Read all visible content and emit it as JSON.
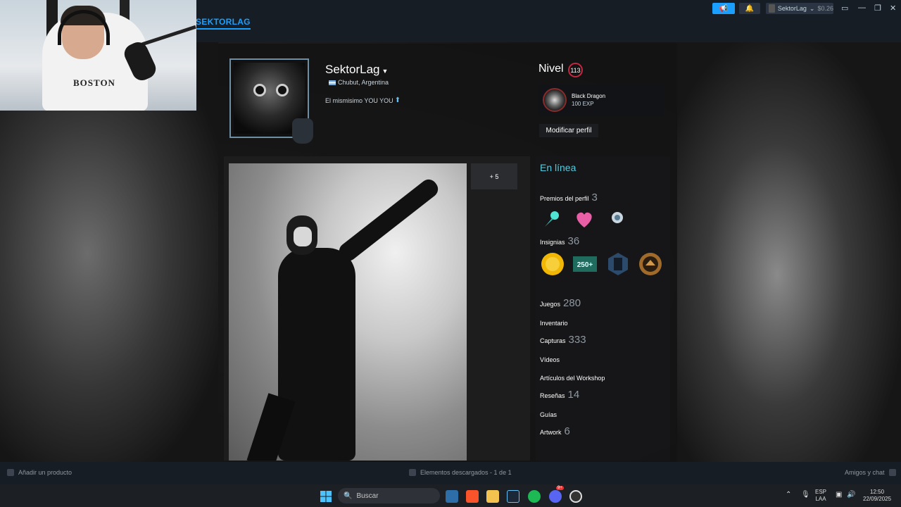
{
  "topbar": {
    "nav_title": "SEKTORLAG",
    "account_name": "SektorLag",
    "balance": "$0.26"
  },
  "webcam": {
    "shirt_text": "BOSTON"
  },
  "profile": {
    "persona_name": "SektorLag",
    "location": "Chubut, Argentina",
    "summary": "El mismisimo YOU YOU",
    "level_label": "Nivel",
    "level_value": "113",
    "badge_name": "Black Dragon",
    "badge_xp": "100 EXP",
    "edit_button": "Modificar perfil"
  },
  "showcase": {
    "more_label": "+ 5"
  },
  "sidebar": {
    "status": "En línea",
    "awards_label": "Premios del perfil",
    "awards_count": "3",
    "badges_label": "Insignias",
    "badges_count": "36",
    "badge_250_label": "250+",
    "stats": [
      {
        "label": "Juegos",
        "count": "280"
      },
      {
        "label": "Inventario",
        "count": ""
      },
      {
        "label": "Capturas",
        "count": "333"
      },
      {
        "label": "Vídeos",
        "count": ""
      },
      {
        "label": "Artículos del Workshop",
        "count": ""
      },
      {
        "label": "Reseñas",
        "count": "14"
      },
      {
        "label": "Guías",
        "count": ""
      },
      {
        "label": "Artwork",
        "count": "6"
      }
    ]
  },
  "bottombar": {
    "add_product": "Añadir un producto",
    "downloads": "Elementos descargados - 1 de 1",
    "friends_chat": "Amigos y chat"
  },
  "taskbar": {
    "search_placeholder": "Buscar",
    "lang_top": "ESP",
    "lang_bottom": "LAA",
    "time": "12:50",
    "date": "22/09/2025",
    "discord_badge": "9+"
  },
  "colors": {
    "accent": "#1a9fff",
    "online": "#57cbde",
    "level_ring": "#c02942"
  }
}
